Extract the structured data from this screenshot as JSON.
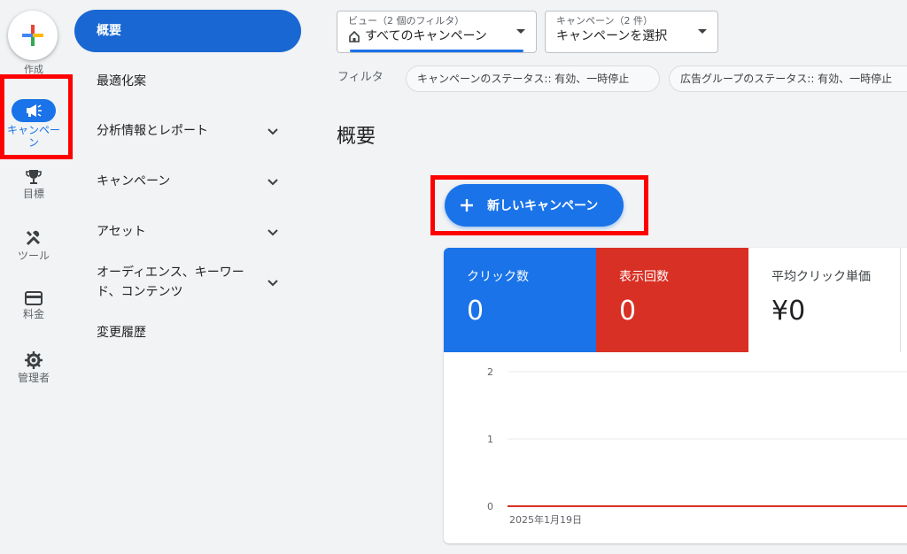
{
  "rail": {
    "create_label": "作成",
    "items": [
      {
        "label": "キャンペーン",
        "icon": "megaphone-icon"
      },
      {
        "label": "目標",
        "icon": "trophy-icon"
      },
      {
        "label": "ツール",
        "icon": "tools-icon"
      },
      {
        "label": "料金",
        "icon": "credit-card-icon"
      },
      {
        "label": "管理者",
        "icon": "gear-icon"
      }
    ]
  },
  "nav": {
    "items": [
      {
        "label": "概要"
      },
      {
        "label": "最適化案"
      },
      {
        "label": "分析情報とレポート"
      },
      {
        "label": "キャンペーン"
      },
      {
        "label": "アセット"
      },
      {
        "label": "オーディエンス、キーワード、コンテンツ"
      },
      {
        "label": "変更履歴"
      }
    ]
  },
  "toolbar": {
    "view": {
      "label": "ビュー（2 個のフィルタ）",
      "value": "すべてのキャンペーン"
    },
    "campaign": {
      "label": "キャンペーン（2 件）",
      "value": "キャンペーンを選択"
    }
  },
  "filters": {
    "label": "フィルタ",
    "chips": [
      "キャンペーンのステータス:: 有効、一時停止",
      "広告グループのステータス:: 有効、一時停止"
    ]
  },
  "main": {
    "title": "概要",
    "new_campaign_label": "新しいキャンペーン"
  },
  "metrics": [
    {
      "label": "クリック数",
      "value": "0",
      "color": "#1a73e8"
    },
    {
      "label": "表示回数",
      "value": "0",
      "color": "#d93025"
    },
    {
      "label": "平均クリック単価",
      "value": "¥0",
      "color": "#ffffff"
    }
  ],
  "chart": {
    "y_ticks": [
      "2",
      "1",
      "0"
    ],
    "x_label": "2025年1月19日"
  },
  "colors": {
    "accent": "#1a73e8",
    "alert": "#d93025",
    "highlight": "#ff0000"
  }
}
